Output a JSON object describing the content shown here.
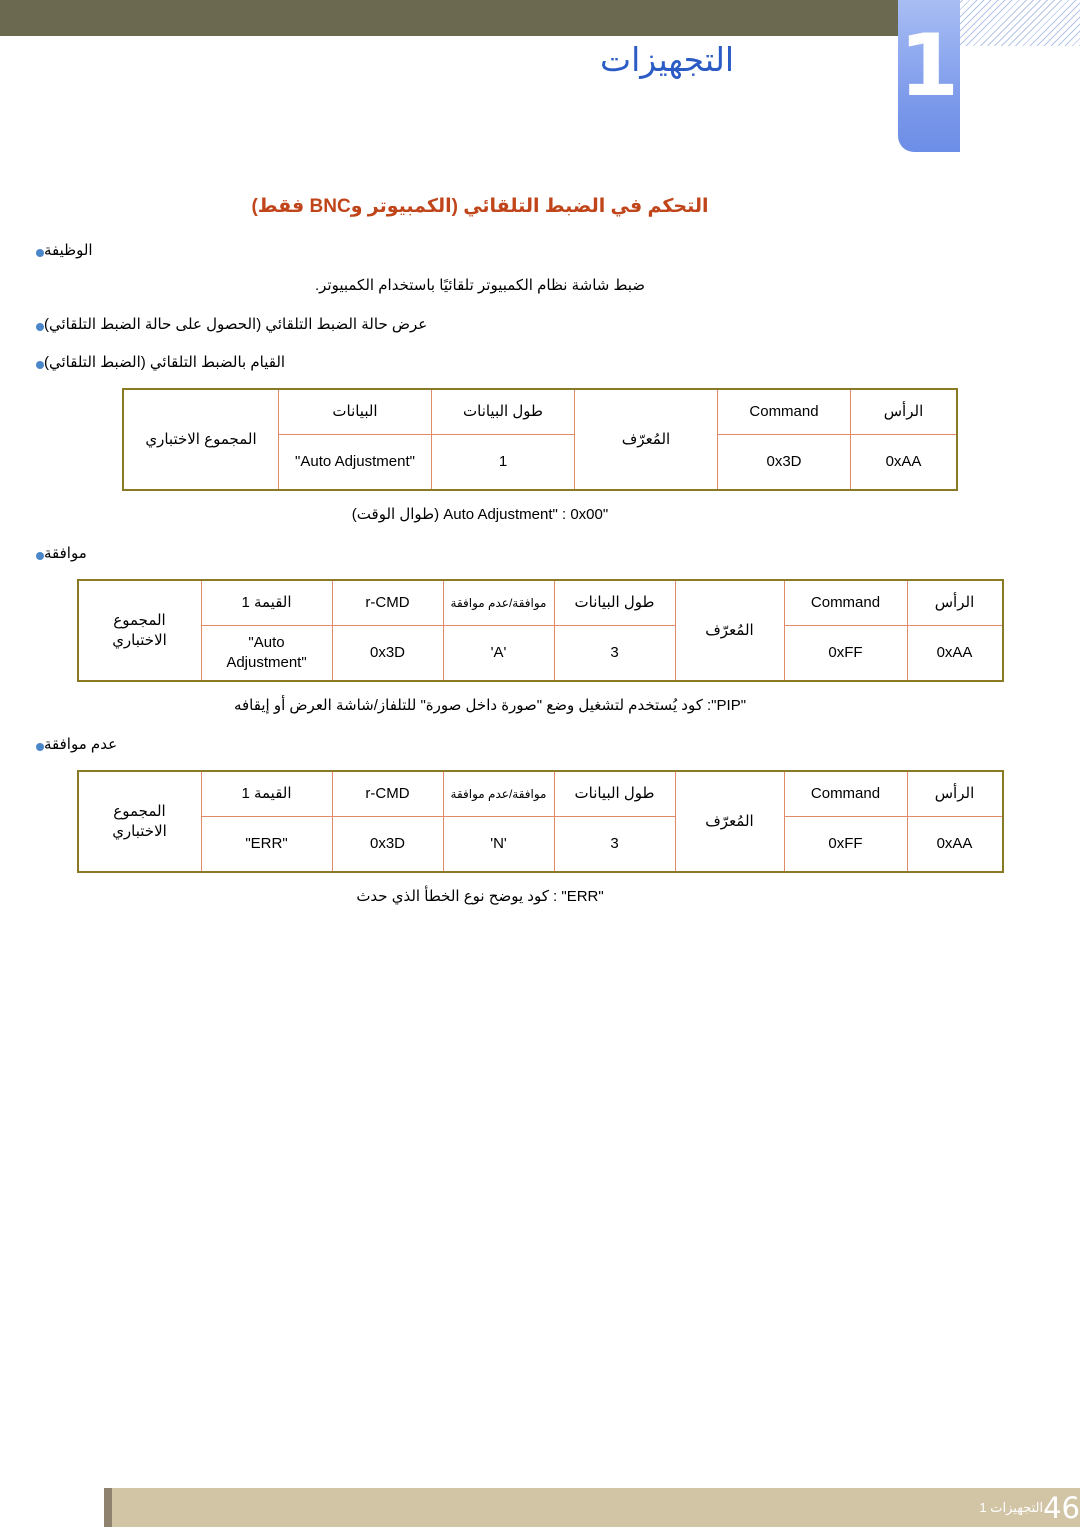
{
  "header": {
    "chapter_number": "1",
    "chapter_title": "التجهيزات"
  },
  "section": {
    "heading": "التحكم في الضبط التلقائي (الكمبيوتر وBNC فقط)"
  },
  "bullets": {
    "function": "الوظيفة",
    "approve": "موافقة",
    "disapprove": "عدم موافقة",
    "show_state": "عرض حالة الضبط التلقائي (الحصول على حالة الضبط التلقائي)",
    "do_auto": "القيام بالضبط التلقائي (الضبط التلقائي)"
  },
  "paragraphs": {
    "function_desc": "ضبط شاشة نظام الكمبيوتر تلقائيًا باستخدام الكمبيوتر.",
    "auto_adjust_note": "\"Auto Adjustment\" : 0x00 (طوال الوقت)",
    "pip_note": "\"PIP\": كود يُستخدم لتشغيل وضع \"صورة داخل صورة\" للتلفاز/شاشة العرض أو إيقافه",
    "err_note": "\"ERR\" : كود يوضح نوع الخطأ الذي حدث"
  },
  "tables": {
    "table1": {
      "headers": {
        "head": "الرأس",
        "command": "Command",
        "id": "المُعرّف",
        "data_length": "طول البيانات",
        "data": "البيانات",
        "checksum": "المجموع الاختباري"
      },
      "values": {
        "head": "0xAA",
        "command": "0x3D",
        "data_length": "1",
        "data": "\"Auto Adjustment\""
      }
    },
    "table2": {
      "headers": {
        "head": "الرأس",
        "command": "Command",
        "id": "المُعرّف",
        "data_length": "طول البيانات",
        "ack": "موافقة/عدم موافقة",
        "rcmd": "r-CMD",
        "value1": "القيمة 1",
        "checksum": "المجموع الاختباري"
      },
      "values": {
        "head": "0xAA",
        "command": "0xFF",
        "data_length": "3",
        "ack": "'A'",
        "rcmd": "0x3D",
        "value1": "\"Auto Adjustment\""
      }
    },
    "table3": {
      "headers": {
        "head": "الرأس",
        "command": "Command",
        "id": "المُعرّف",
        "data_length": "طول البيانات",
        "ack": "موافقة/عدم موافقة",
        "rcmd": "r-CMD",
        "value1": "القيمة 1",
        "checksum": "المجموع الاختباري"
      },
      "values": {
        "head": "0xAA",
        "command": "0xFF",
        "data_length": "3",
        "ack": "'N'",
        "rcmd": "0x3D",
        "value1": "\"ERR\""
      }
    }
  },
  "footer": {
    "label": "التجهيزات 1",
    "page": "46"
  },
  "colors": {
    "header_bar": "#6b6950",
    "chapter_tab": "#8fa9ef",
    "chapter_title": "#2b5bc4",
    "heading": "#c0451a",
    "bullet": "#4a86c8",
    "table_outer_border": "#8a7a24",
    "table_inner_border": "#e08a6a",
    "footer_bar": "#d2c5a5"
  }
}
